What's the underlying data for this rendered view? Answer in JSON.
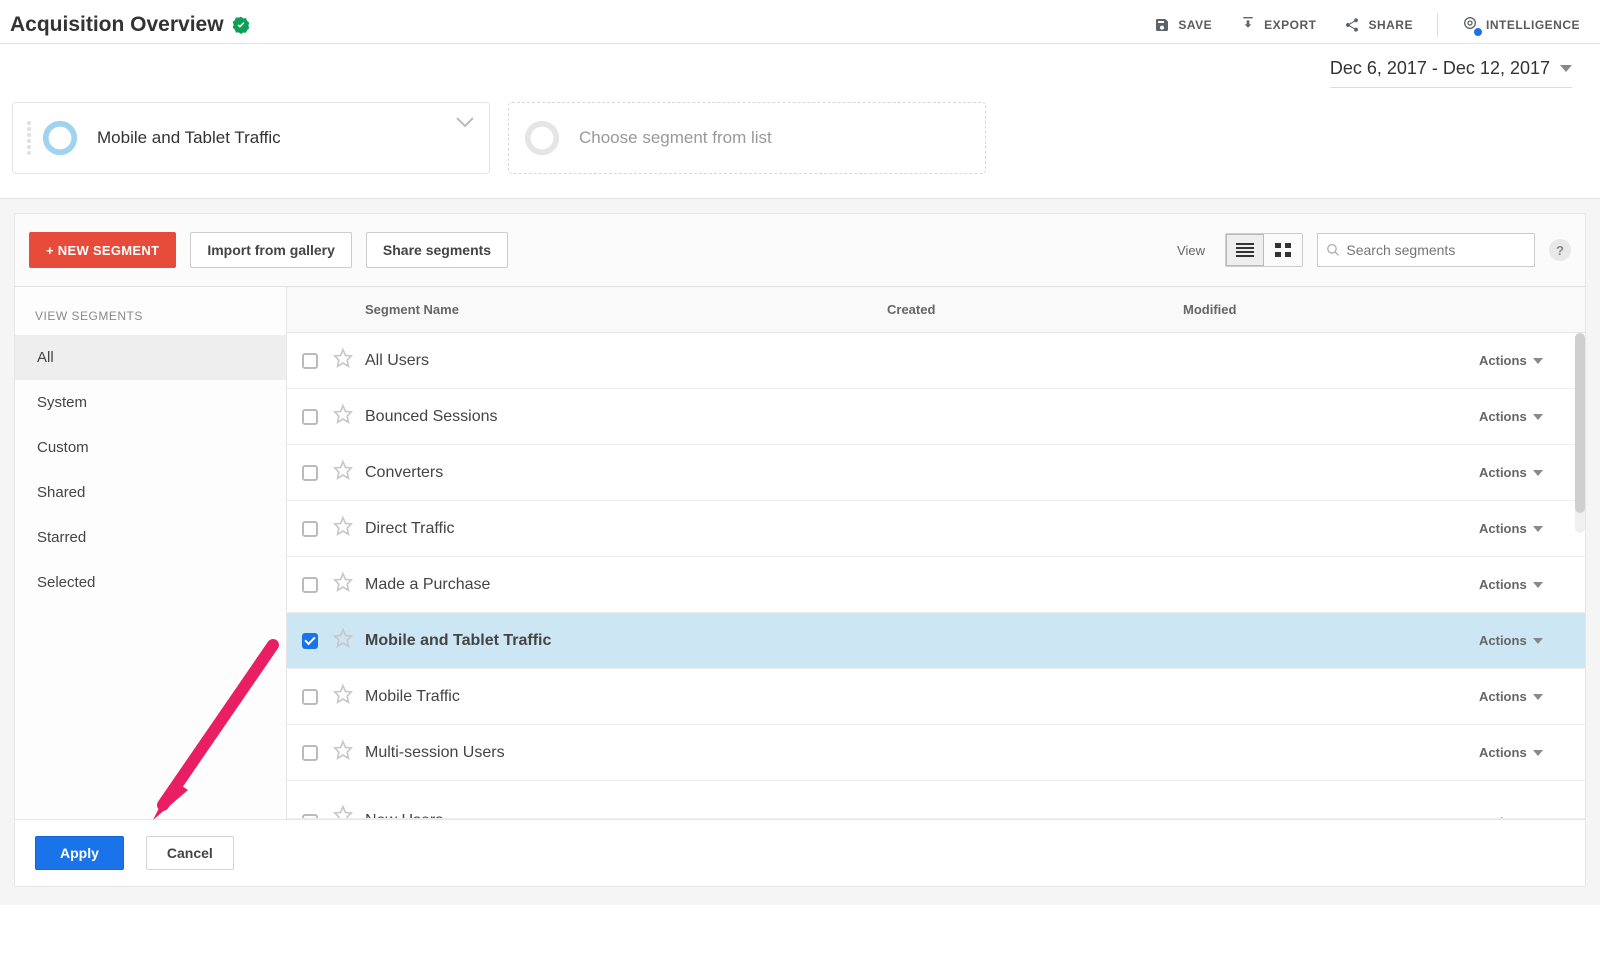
{
  "header": {
    "title": "Acquisition Overview",
    "actions": {
      "save": "SAVE",
      "export": "EXPORT",
      "share": "SHARE",
      "intelligence": "INTELLIGENCE"
    }
  },
  "date_range": "Dec 6, 2017 - Dec 12, 2017",
  "segments_row": {
    "selected": "Mobile and Tablet Traffic",
    "choose": "Choose segment from list"
  },
  "toolbar": {
    "new_segment": "+ NEW SEGMENT",
    "import": "Import from gallery",
    "share": "Share segments",
    "view_label": "View",
    "search_placeholder": "Search segments"
  },
  "left_nav": {
    "heading": "VIEW SEGMENTS",
    "items": [
      "All",
      "System",
      "Custom",
      "Shared",
      "Starred",
      "Selected"
    ],
    "active": "All"
  },
  "table": {
    "headers": {
      "name": "Segment Name",
      "created": "Created",
      "modified": "Modified"
    },
    "actions_label": "Actions",
    "rows": [
      {
        "name": "All Users",
        "checked": false
      },
      {
        "name": "Bounced Sessions",
        "checked": false
      },
      {
        "name": "Converters",
        "checked": false
      },
      {
        "name": "Direct Traffic",
        "checked": false
      },
      {
        "name": "Made a Purchase",
        "checked": false
      },
      {
        "name": "Mobile and Tablet Traffic",
        "checked": true
      },
      {
        "name": "Mobile Traffic",
        "checked": false
      },
      {
        "name": "Multi-session Users",
        "checked": false
      },
      {
        "name": "New Users",
        "checked": false
      }
    ]
  },
  "footer": {
    "apply": "Apply",
    "cancel": "Cancel"
  }
}
